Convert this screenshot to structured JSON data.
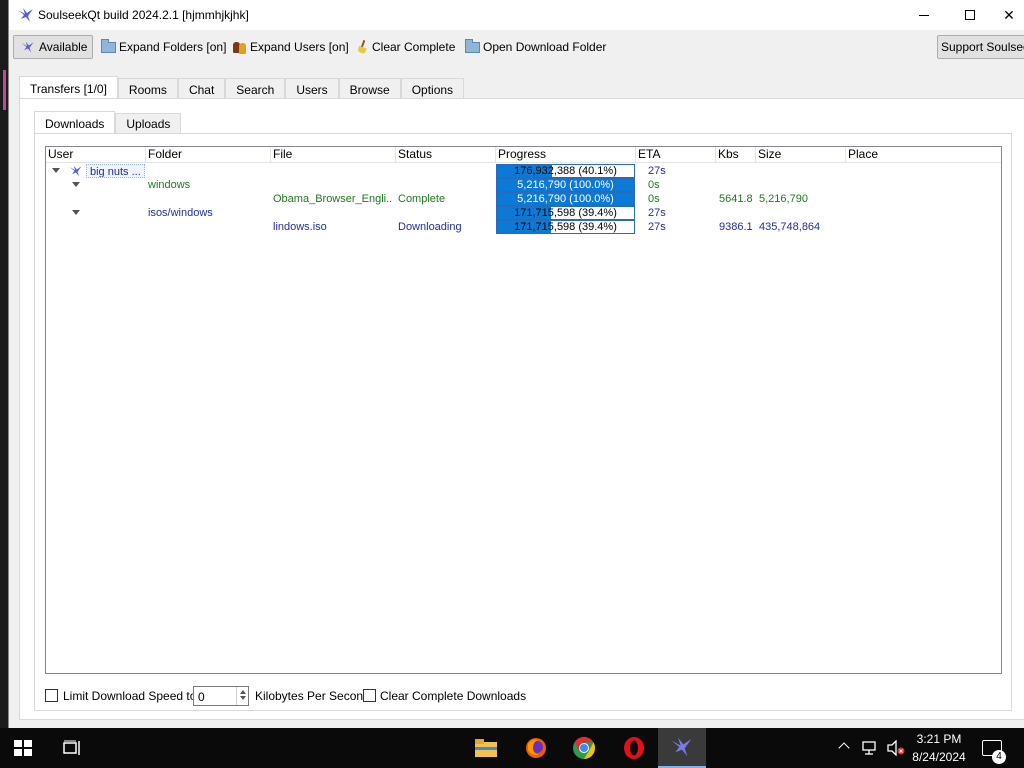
{
  "window": {
    "title": "SoulseekQt build 2024.2.1 [hjmmhjkjhk]"
  },
  "toolbar": {
    "available": "Available",
    "expand_folders": "Expand Folders [on]",
    "expand_users": "Expand Users [on]",
    "clear_complete": "Clear Complete",
    "open_download_folder": "Open Download Folder",
    "support": "Support Soulseek"
  },
  "tabs": {
    "transfers": "Transfers [1/0]",
    "rooms": "Rooms",
    "chat": "Chat",
    "search": "Search",
    "users": "Users",
    "browse": "Browse",
    "options": "Options"
  },
  "subtabs": {
    "downloads": "Downloads",
    "uploads": "Uploads"
  },
  "columns": {
    "user": "User",
    "folder": "Folder",
    "file": "File",
    "status": "Status",
    "progress": "Progress",
    "eta": "ETA",
    "kbs": "Kbs",
    "size": "Size",
    "place": "Place"
  },
  "rows": [
    {
      "user": "big nuts ...",
      "folder": "",
      "file": "",
      "status": "",
      "progress_text": "176,932,388 (40.1%)",
      "progress_fraction": 0.401,
      "eta": "27s",
      "kbs": "",
      "size": ""
    },
    {
      "user": "",
      "folder": "windows",
      "file": "",
      "status": "",
      "progress_text": "5,216,790 (100.0%)",
      "progress_fraction": 1.0,
      "eta": "0s",
      "kbs": "",
      "size": ""
    },
    {
      "user": "",
      "folder": "",
      "file": "Obama_Browser_Engli...",
      "status": "Complete",
      "progress_text": "5,216,790 (100.0%)",
      "progress_fraction": 1.0,
      "eta": "0s",
      "kbs": "5641.8",
      "size": "5,216,790"
    },
    {
      "user": "",
      "folder": "isos/windows",
      "file": "",
      "status": "",
      "progress_text": "171,715,598 (39.4%)",
      "progress_fraction": 0.394,
      "eta": "27s",
      "kbs": "",
      "size": ""
    },
    {
      "user": "",
      "folder": "",
      "file": "lindows.iso",
      "status": "Downloading",
      "progress_text": "171,715,598 (39.4%)",
      "progress_fraction": 0.394,
      "eta": "27s",
      "kbs": "9386.1",
      "size": "435,748,864"
    }
  ],
  "bottom": {
    "limit_label": "Limit Download Speed to",
    "limit_value": "0",
    "unit_label": "Kilobytes Per Second",
    "clear_complete_label": "Clear Complete Downloads"
  },
  "taskbar": {
    "time": "3:21 PM",
    "date": "8/24/2024",
    "notification_count": "4"
  },
  "colors": {
    "progress_fill": "#0b7ad6",
    "text_blue": "#1f2fa0",
    "text_green": "#1f7a1f"
  }
}
